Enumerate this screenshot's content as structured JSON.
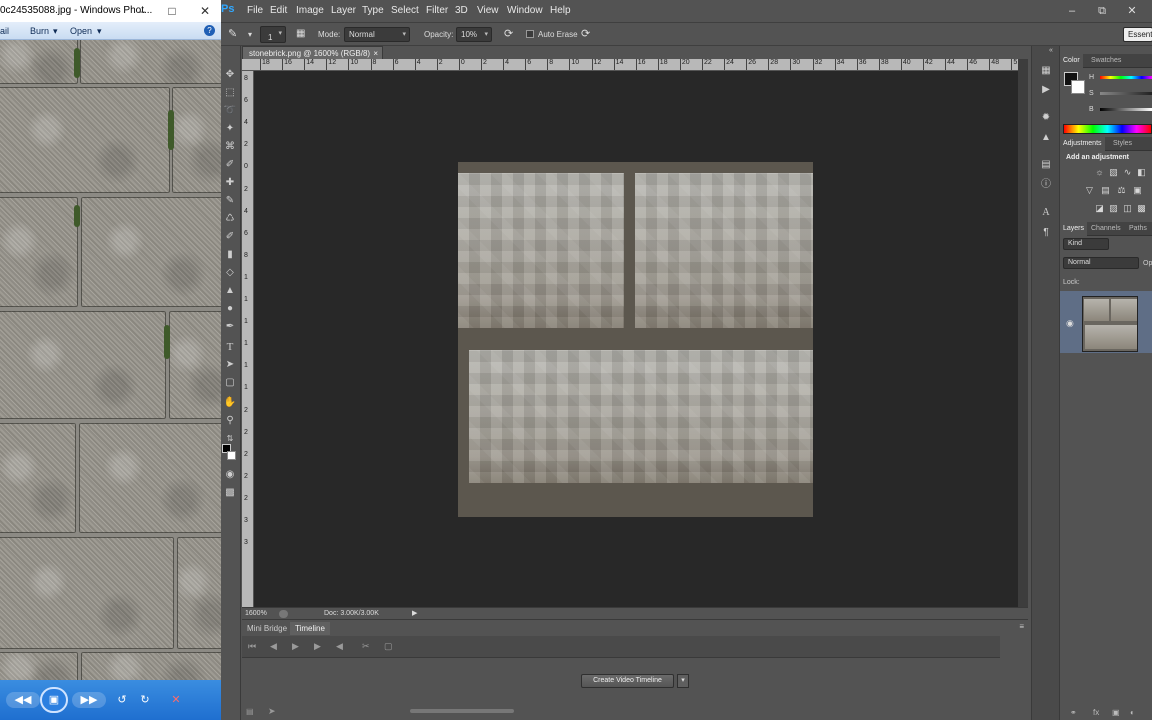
{
  "photo_viewer": {
    "title": "0c24535088.jpg - Windows Phot...",
    "menu": [
      "ail",
      "Burn",
      "Open"
    ],
    "bottom_controls": [
      "prev-icon",
      "slideshow-icon",
      "next-icon",
      "rotate-left-icon",
      "rotate-right-icon",
      "delete-icon"
    ]
  },
  "photoshop": {
    "logo": "Ps",
    "menus": [
      "File",
      "Edit",
      "Image",
      "Layer",
      "Type",
      "Select",
      "Filter",
      "3D",
      "View",
      "Window",
      "Help"
    ],
    "options_bar": {
      "brush_size": "1",
      "mode_label": "Mode:",
      "mode_value": "Normal",
      "opacity_label": "Opacity:",
      "opacity_value": "10%",
      "auto_erase_label": "Auto Erase",
      "workspace": "Essent"
    },
    "doc_tab": "stonebrick.png @ 1600% (RGB/8)",
    "doc_tab_close": "×",
    "ruler_h": [
      "18",
      "16",
      "14",
      "12",
      "10",
      "8",
      "6",
      "4",
      "2",
      "0",
      "2",
      "4",
      "6",
      "8",
      "10",
      "12",
      "14",
      "16",
      "18",
      "20",
      "22",
      "24",
      "26",
      "28",
      "30",
      "32",
      "34",
      "36",
      "38",
      "40",
      "42",
      "44",
      "46",
      "48",
      "5"
    ],
    "ruler_v": [
      "8",
      "6",
      "4",
      "2",
      "0",
      "2",
      "4",
      "6",
      "8",
      "1",
      "1",
      "1",
      "1",
      "1",
      "1",
      "2",
      "2",
      "2",
      "2",
      "2",
      "3",
      "3"
    ],
    "status": {
      "zoom": "1600%",
      "doc": "Doc: 3.00K/3.00K"
    },
    "timeline": {
      "tabs": [
        "Mini Bridge",
        "Timeline"
      ],
      "create_button": "Create Video Timeline"
    },
    "color_panel": {
      "tabs": [
        "Color",
        "Swatches"
      ],
      "channels": [
        "H",
        "S",
        "B"
      ]
    },
    "adjustments_panel": {
      "tabs": [
        "Adjustments",
        "Styles"
      ],
      "heading": "Add an adjustment"
    },
    "layers_panel": {
      "tabs": [
        "Layers",
        "Channels",
        "Paths"
      ],
      "kind": "Kind",
      "blend": "Normal",
      "opacity_short": "Op",
      "lock_label": "Lock:"
    }
  }
}
